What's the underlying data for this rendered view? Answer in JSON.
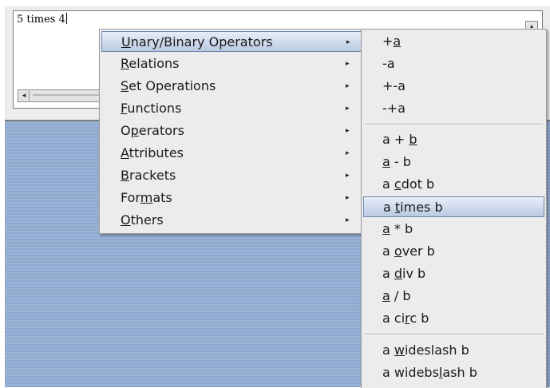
{
  "editor": {
    "text": "5 times 4"
  },
  "menu_main": {
    "items": [
      {
        "pre": "",
        "u": "U",
        "post": "nary/Binary Operators",
        "arrow": "▸"
      },
      {
        "pre": "",
        "u": "R",
        "post": "elations",
        "arrow": "▸"
      },
      {
        "pre": "",
        "u": "S",
        "post": "et Operations",
        "arrow": "▸"
      },
      {
        "pre": "",
        "u": "F",
        "post": "unctions",
        "arrow": "▸"
      },
      {
        "pre": "O",
        "u": "p",
        "post": "erators",
        "arrow": "▸"
      },
      {
        "pre": "",
        "u": "A",
        "post": "ttributes",
        "arrow": "▸"
      },
      {
        "pre": "",
        "u": "B",
        "post": "rackets",
        "arrow": "▸"
      },
      {
        "pre": "For",
        "u": "m",
        "post": "ats",
        "arrow": "▸"
      },
      {
        "pre": "",
        "u": "O",
        "post": "thers",
        "arrow": "▸"
      }
    ]
  },
  "menu_sub": {
    "items": [
      {
        "pre": "+",
        "u": "a",
        "post": ""
      },
      {
        "pre": "-a",
        "u": "",
        "post": ""
      },
      {
        "pre": "+-a",
        "u": "",
        "post": ""
      },
      {
        "pre": "-+a",
        "u": "",
        "post": ""
      },
      {
        "pre": "a + ",
        "u": "b",
        "post": ""
      },
      {
        "pre": "",
        "u": "a",
        "post": " - b"
      },
      {
        "pre": "a ",
        "u": "c",
        "post": "dot b"
      },
      {
        "pre": "a ",
        "u": "t",
        "post": "imes b"
      },
      {
        "pre": "",
        "u": "a",
        "post": " * b"
      },
      {
        "pre": "a ",
        "u": "o",
        "post": "ver b"
      },
      {
        "pre": "a ",
        "u": "d",
        "post": "iv b"
      },
      {
        "pre": "",
        "u": "a",
        "post": " / b"
      },
      {
        "pre": "a ci",
        "u": "r",
        "post": "c b"
      },
      {
        "pre": "a ",
        "u": "w",
        "post": "ideslash b"
      },
      {
        "pre": "a widebs",
        "u": "l",
        "post": "ash b"
      }
    ]
  },
  "icons": {
    "scroll_left": "◂",
    "scroll_up": "▴"
  }
}
